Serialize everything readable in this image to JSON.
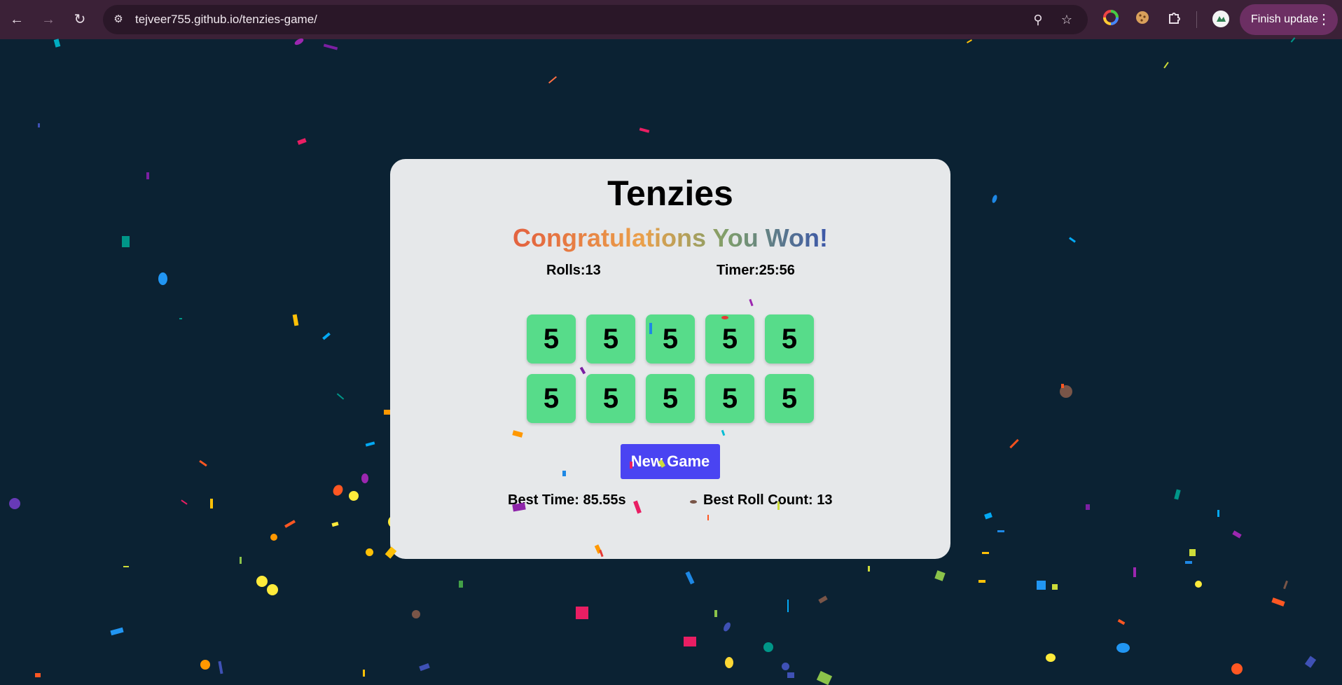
{
  "browser": {
    "url": "tejveer755.github.io/tenzies-game/",
    "update_button_label": "Finish update",
    "icons": {
      "back": "back-arrow-icon",
      "forward": "forward-arrow-icon",
      "reload": "reload-icon",
      "site_info": "site-settings-icon",
      "zoom": "zoom-icon",
      "bookmark": "star-icon",
      "extension_color": "color-wheel-icon",
      "extension_cookie": "cookie-icon",
      "extensions": "puzzle-icon",
      "profile": "profile-avatar-icon",
      "menu": "more-vertical-icon"
    },
    "accent_color": "#3b2137"
  },
  "game": {
    "title": "Tenzies",
    "win_message": "Congratulations You Won!",
    "rolls_label": "Rolls:13",
    "timer_label": "Timer:25:56",
    "dice": [
      "5",
      "5",
      "5",
      "5",
      "5",
      "5",
      "5",
      "5",
      "5",
      "5"
    ],
    "new_game_label": "New Game",
    "best_time_label": "Best Time: 85.55s",
    "best_roll_label": "Best Roll Count: 13",
    "colors": {
      "page_background": "#0b2233",
      "card_background": "#e6e8ea",
      "die_held": "#57dc8a",
      "button": "#4a44f2"
    }
  }
}
